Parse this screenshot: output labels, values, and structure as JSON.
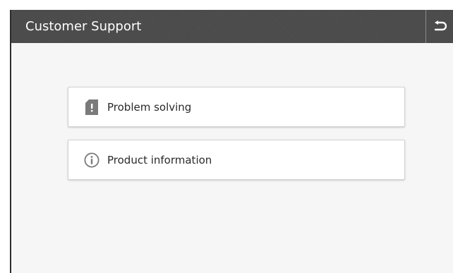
{
  "header": {
    "title": "Customer Support",
    "back_icon": "back-arrow-icon"
  },
  "menu": {
    "items": [
      {
        "label": "Problem solving",
        "icon": "alert-card-icon"
      },
      {
        "label": "Product information",
        "icon": "info-icon"
      }
    ]
  },
  "colors": {
    "header_bg": "#4a4a4a",
    "body_bg": "#f6f6f6",
    "button_bg": "#ffffff",
    "text": "#2a2a2a",
    "icon": "#7a7a7a"
  }
}
